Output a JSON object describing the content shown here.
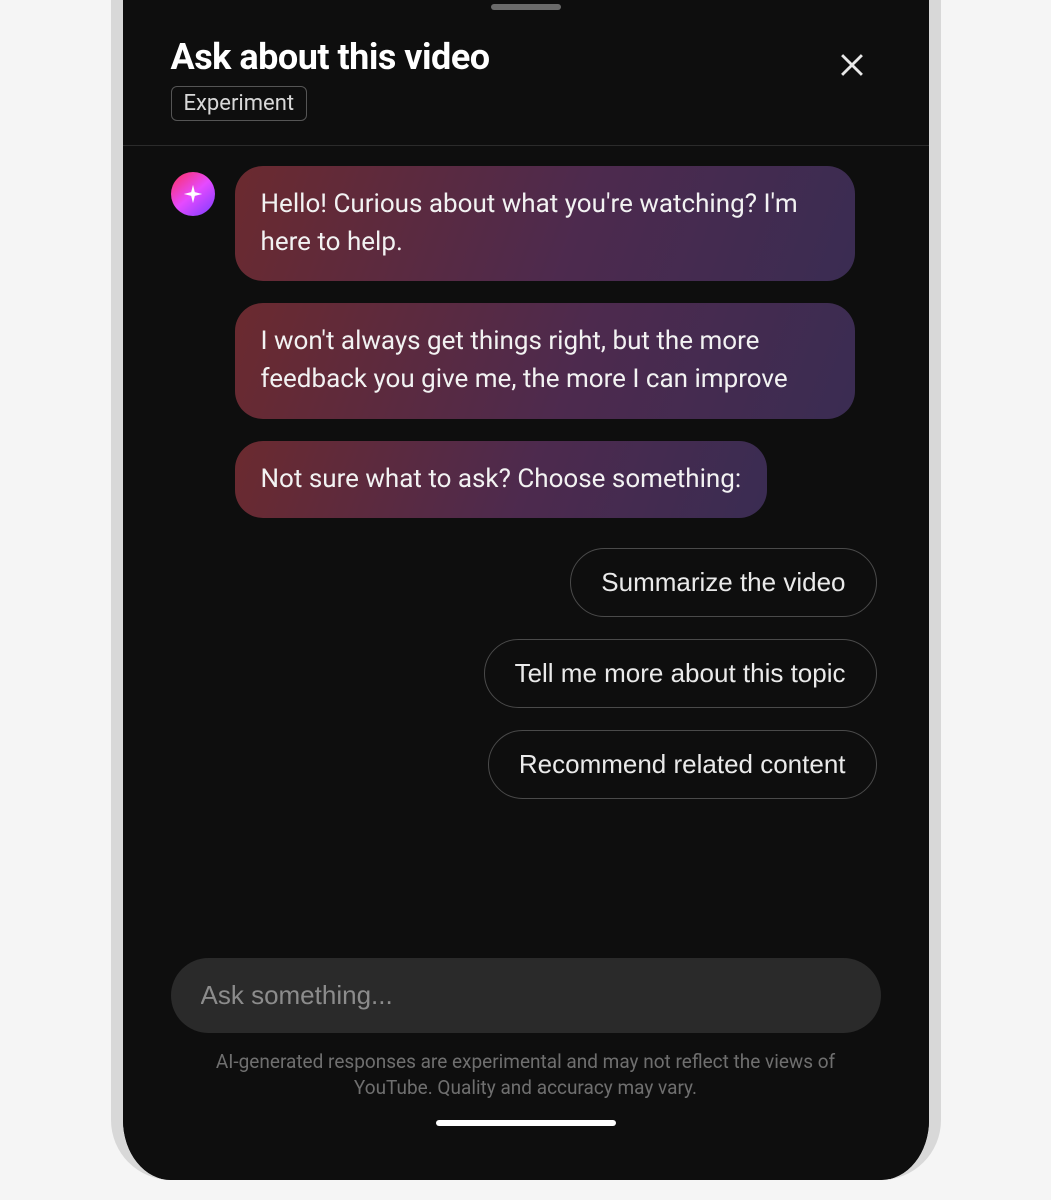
{
  "header": {
    "title": "Ask about this video",
    "badge": "Experiment"
  },
  "messages": [
    "Hello! Curious about what you're watching? I'm here to help.",
    "I won't always get things right, but the more feedback you give me, the more I can improve",
    "Not sure what to ask? Choose something:"
  ],
  "suggestions": [
    "Summarize the video",
    "Tell me more about this topic",
    "Recommend related content"
  ],
  "input": {
    "placeholder": "Ask something..."
  },
  "disclaimer": "AI-generated responses are experimental and may not reflect the views of YouTube. Quality and accuracy may vary."
}
